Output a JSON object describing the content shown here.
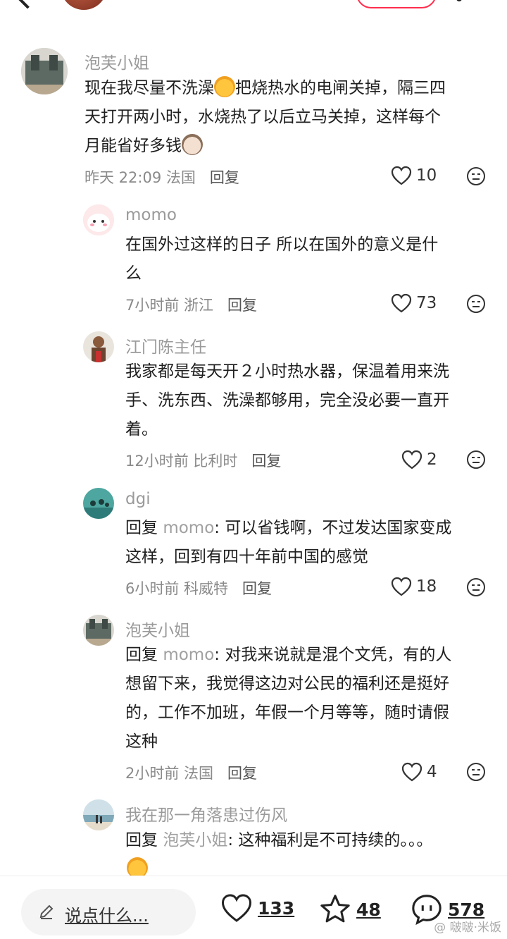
{
  "comments": [
    {
      "user": "泡芙小姐",
      "text_a": "现在我尽量不洗澡",
      "text_b": "把烧热水的电闸关掉，隔三四",
      "line2": "天打开两小时，水烧热了以后立马关掉，这样每个",
      "line3": "月能省好多钱",
      "time": "昨天 22:09 法国",
      "reply": "回复",
      "likes": "10"
    },
    {
      "user": "momo",
      "line1": "在国外过这样的日子 所以在国外的意义是什",
      "line2": "么",
      "time": "7小时前 浙江",
      "reply": "回复",
      "likes": "73"
    },
    {
      "user": "江门陈主任",
      "line1": "我家都是每天开２小时热水器，保温着用来洗",
      "line2": "手、洗东西、洗澡都够用，完全没必要一直开",
      "line3": "着。",
      "time": "12小时前 比利时",
      "reply": "回复",
      "likes": "2"
    },
    {
      "user": "dgi",
      "reply_word": "回复",
      "reply_target": "momo",
      "line1_rest": ": 可以省钱啊，不过发达国家变成",
      "line2": "这样，回到有四十年前中国的感觉",
      "time": "6小时前 科威特",
      "reply": "回复",
      "likes": "18"
    },
    {
      "user": "泡芙小姐",
      "reply_word": "回复",
      "reply_target": "momo",
      "line1_rest": ": 对我来说就是混个文凭，有的人",
      "line2": "想留下来，我觉得这边对公民的福利还是挺好",
      "line3": "的，工作不加班，年假一个月等等，随时请假",
      "line4": "这种",
      "time": "2小时前 法国",
      "reply": "回复",
      "likes": "4"
    },
    {
      "user": "我在那一角落患过伤风",
      "reply_word": "回复",
      "reply_target": "泡芙小姐",
      "line1_rest": ": 这种福利是不可持续的。。。"
    }
  ],
  "bottom": {
    "placeholder": "说点什么...",
    "likes": "133",
    "stars": "48",
    "comments": "578"
  },
  "watermark": "@ 啵啵·米饭"
}
